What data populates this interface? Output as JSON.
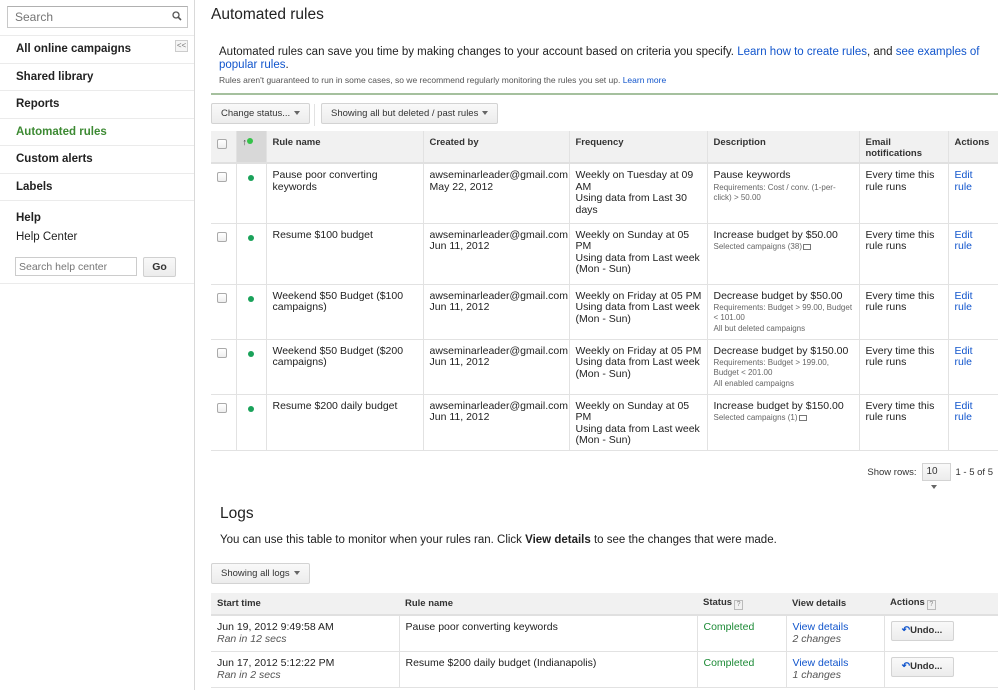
{
  "sidebar": {
    "search_placeholder": "Search",
    "collapse_label": "<<",
    "nav": [
      {
        "label": "All online campaigns",
        "active": false
      },
      {
        "label": "Shared library",
        "active": false
      },
      {
        "label": "Reports",
        "active": false
      },
      {
        "label": "Automated rules",
        "active": true
      },
      {
        "label": "Custom alerts",
        "active": false
      },
      {
        "label": "Labels",
        "active": false
      }
    ],
    "help_title": "Help",
    "help_center": "Help Center",
    "help_search_placeholder": "Search help center",
    "go_label": "Go"
  },
  "main": {
    "title": "Automated rules",
    "intro": {
      "text_before": "Automated rules can save you time by making changes to your account based on criteria you specify. ",
      "link1": "Learn how to create rules",
      "text_mid": ", and ",
      "link2": "see examples of popular rules",
      "text_end": ".",
      "note": "Rules aren't guaranteed to run in some cases, so we recommend regularly monitoring the rules you set up. ",
      "note_link": "Learn more"
    },
    "toolbar": {
      "change_status": "Change status...",
      "filter": "Showing all but deleted / past rules"
    },
    "rules_table": {
      "headers": {
        "sort_arrow": "↑",
        "rule_name": "Rule name",
        "created_by": "Created by",
        "frequency": "Frequency",
        "description": "Description",
        "email_1": "Email",
        "email_2": "notifications",
        "actions": "Actions"
      },
      "rows": [
        {
          "rule_name": "Pause poor converting keywords",
          "created_email": "awseminarleader@gmail.com",
          "created_date": "May 22, 2012",
          "frequency": "Weekly on Tuesday at 09 AM",
          "frequency_data": "Using data from Last 30 days",
          "desc_main": "Pause keywords",
          "desc_sub1": "Requirements: Cost / conv. (1-per-click) > 50.00",
          "desc_sub2": "",
          "email": "Every time this rule runs",
          "action": "Edit rule"
        },
        {
          "rule_name": "Resume $100 budget",
          "created_email": "awseminarleader@gmail.com",
          "created_date": "Jun 11, 2012",
          "frequency": "Weekly on Sunday at 05 PM",
          "frequency_data": "Using data from Last week (Mon - Sun)",
          "desc_main": "Increase budget by $50.00",
          "desc_sub1": "Selected campaigns (38)",
          "desc_sub2": "",
          "email": "Every time this rule runs",
          "action": "Edit rule"
        },
        {
          "rule_name": "Weekend $50 Budget ($100 campaigns)",
          "created_email": "awseminarleader@gmail.com",
          "created_date": "Jun 11, 2012",
          "frequency": "Weekly on Friday at 05 PM",
          "frequency_data": "Using data from Last week (Mon - Sun)",
          "desc_main": "Decrease budget by $50.00",
          "desc_sub1": "Requirements: Budget > 99.00, Budget < 101.00",
          "desc_sub2": "All but deleted campaigns",
          "email": "Every time this rule runs",
          "action": "Edit rule"
        },
        {
          "rule_name": "Weekend $50 Budget ($200 campaigns)",
          "created_email": "awseminarleader@gmail.com",
          "created_date": "Jun 11, 2012",
          "frequency": "Weekly on Friday at 05 PM",
          "frequency_data": "Using data from Last week (Mon - Sun)",
          "desc_main": "Decrease budget by $150.00",
          "desc_sub1": "Requirements: Budget > 199.00, Budget < 201.00",
          "desc_sub2": "All enabled campaigns",
          "email": "Every time this rule runs",
          "action": "Edit rule"
        },
        {
          "rule_name": "Resume $200 daily budget",
          "created_email": "awseminarleader@gmail.com",
          "created_date": "Jun 11, 2012",
          "frequency": "Weekly on Sunday at 05 PM",
          "frequency_data": "Using data from Last week (Mon - Sun)",
          "desc_main": "Increase budget by $150.00",
          "desc_sub1": "Selected campaigns (1)",
          "desc_sub2": "",
          "email": "Every time this rule runs",
          "action": "Edit rule"
        }
      ]
    },
    "pager": {
      "show_rows_label": "Show rows:",
      "rows_value": "10",
      "range": "1 - 5 of 5"
    },
    "logs": {
      "title": "Logs",
      "intro_before": "You can use this table to monitor when your rules ran. Click ",
      "intro_bold": "View details",
      "intro_after": " to see the changes that were made.",
      "filter": "Showing all logs",
      "headers": {
        "start_time": "Start time",
        "rule_name": "Rule name",
        "status": "Status",
        "view_details": "View details",
        "actions": "Actions",
        "help_mark": "?"
      },
      "rows": [
        {
          "start_time": "Jun 19, 2012 9:49:58 AM",
          "duration": "Ran in 12 secs",
          "rule_name": "Pause poor converting keywords",
          "status": "Completed",
          "view_details": "View details",
          "changes": "2 changes",
          "action": "Undo..."
        },
        {
          "start_time": "Jun 17, 2012 5:12:22 PM",
          "duration": "Ran in 2 secs",
          "rule_name": "Resume $200 daily budget (Indianapolis)",
          "status": "Completed",
          "view_details": "View details",
          "changes": "1 changes",
          "action": "Undo..."
        }
      ]
    }
  },
  "colors": {
    "active_nav": "#3d8a33",
    "link": "#1155cc",
    "status_enabled_dot": "#1aa25a",
    "completed": "#1c8a36",
    "divider": "#a5c09e"
  }
}
